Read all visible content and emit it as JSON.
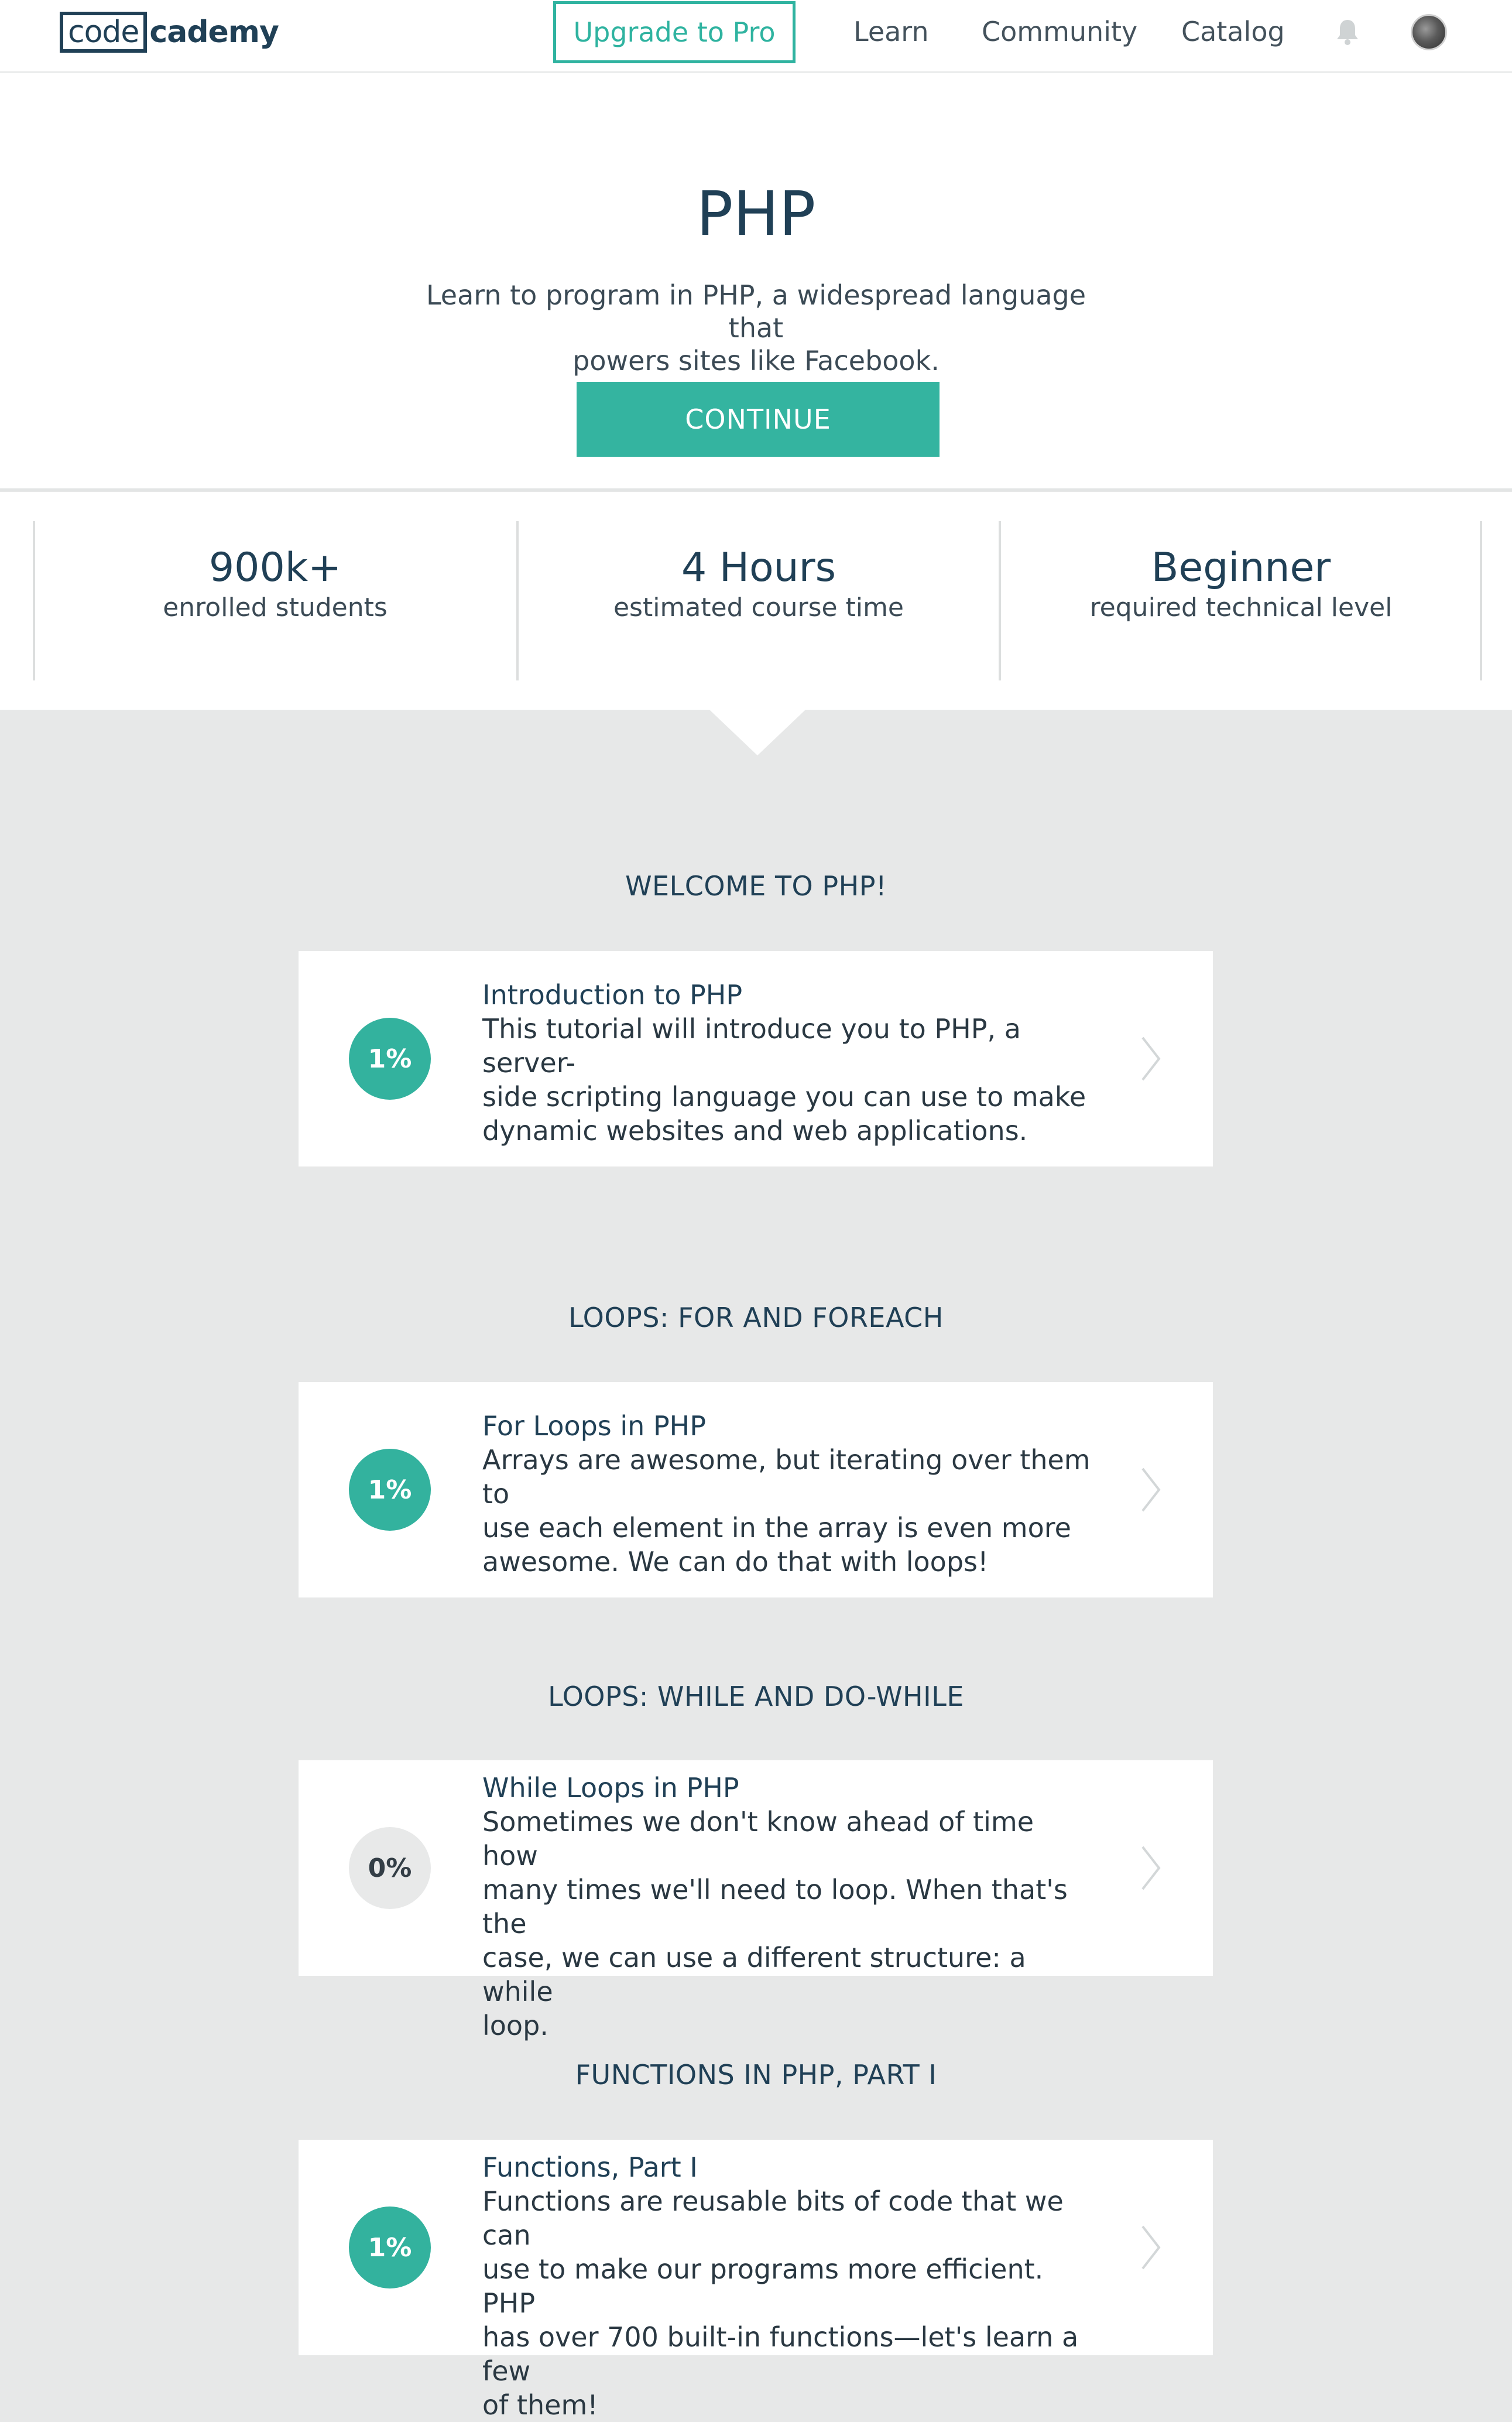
{
  "header": {
    "logo_box": "code",
    "logo_rest": "cademy",
    "upgrade_label": "Upgrade to Pro",
    "nav": [
      "Learn",
      "Community",
      "Catalog"
    ],
    "bell_icon": "bell-icon",
    "avatar_icon": "avatar"
  },
  "hero": {
    "title": "PHP",
    "subtitle_line1": "Learn to program in PHP, a widespread language that",
    "subtitle_line2": "powers sites like Facebook.",
    "continue_label": "CONTINUE",
    "accent_color": "#34b4a0"
  },
  "stats": [
    {
      "value": "900k+",
      "label": "enrolled students"
    },
    {
      "value": "4 Hours",
      "label": "estimated course time"
    },
    {
      "value": "Beginner",
      "label": "required technical level"
    }
  ],
  "sections": [
    {
      "title": "WELCOME TO PHP!",
      "card": {
        "progress": "1%",
        "title": "Introduction to PHP",
        "desc": [
          "This tutorial will introduce you to PHP, a server-",
          "side scripting language you can use to make",
          "dynamic websites and web applications."
        ]
      }
    },
    {
      "title": "LOOPS: FOR AND FOREACH",
      "card": {
        "progress": "1%",
        "title": "For Loops in PHP",
        "desc": [
          "Arrays are awesome, but iterating over them to",
          "use each element in the array is even more",
          "awesome. We can do that with loops!"
        ]
      }
    },
    {
      "title": "LOOPS: WHILE AND DO-WHILE",
      "card": {
        "progress": "0%",
        "title": "While Loops in PHP",
        "desc": [
          "Sometimes we don't know ahead of time how",
          "many times we'll need to loop. When that's the",
          "case, we can use a different structure: a while",
          "loop."
        ]
      }
    },
    {
      "title": "FUNCTIONS IN PHP, PART I",
      "card": {
        "progress": "1%",
        "title": "Functions, Part I",
        "desc": [
          "Functions are reusable bits of code that we can",
          "use to make our programs more efficient. PHP",
          "has over 700 built-in functions—let's learn a few",
          "of them!"
        ]
      }
    }
  ]
}
